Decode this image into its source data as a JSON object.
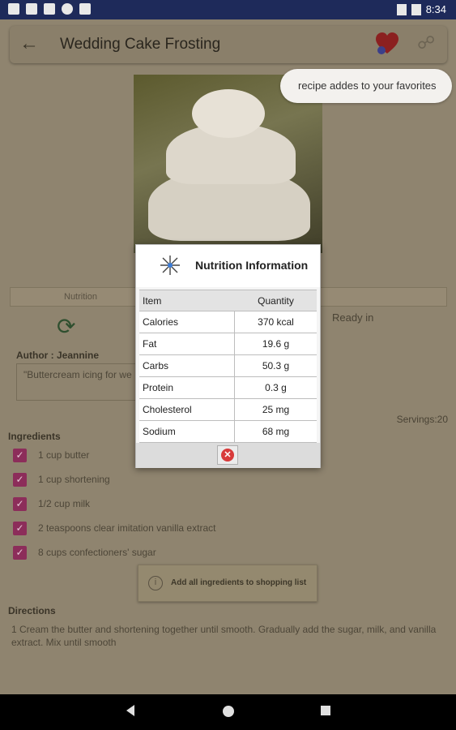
{
  "status_bar": {
    "time": "8:34"
  },
  "app_bar": {
    "title": "Wedding Cake Frosting"
  },
  "toast": {
    "text": "recipe addes to your favorites"
  },
  "tabs": {
    "first_label": "Nutrition"
  },
  "ready_label": "Ready in",
  "author": "Author : Jeannine",
  "description": "\"Buttercream icing for we",
  "servings": "Servings:20",
  "ingredients_heading": "Ingredients",
  "ingredients": [
    "1 cup butter",
    "1 cup shortening",
    "1/2 cup milk",
    "2 teaspoons clear imitation vanilla extract",
    "8 cups confectioners' sugar"
  ],
  "shopping_button": "Add all ingredients to shopping list",
  "directions_heading": "Directions",
  "directions": [
    "1  Cream the butter and shortening together until smooth. Gradually add the sugar, milk, and vanilla extract.  Mix until smooth"
  ],
  "nutrition_dialog": {
    "title": "Nutrition Information",
    "header": {
      "item": "Item",
      "quantity": "Quantity"
    },
    "rows": [
      {
        "item": "Calories",
        "quantity": "370 kcal"
      },
      {
        "item": "Fat",
        "quantity": "19.6 g"
      },
      {
        "item": "Carbs",
        "quantity": "50.3 g"
      },
      {
        "item": "Protein",
        "quantity": "0.3 g"
      },
      {
        "item": "Cholesterol",
        "quantity": "25 mg"
      },
      {
        "item": "Sodium",
        "quantity": "68 mg"
      }
    ]
  },
  "colors": {
    "status_bar": "#1e2a5a",
    "accent_checkbox": "#8c2d5a",
    "close_icon": "#d83a3a"
  }
}
